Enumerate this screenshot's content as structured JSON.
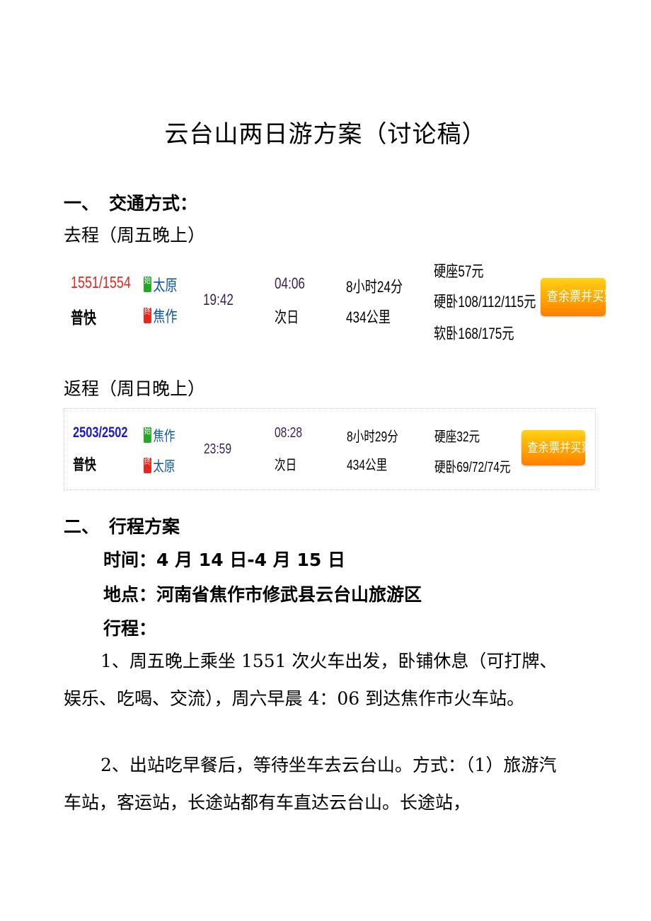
{
  "title": "云台山两日游方案（讨论稿）",
  "section1": {
    "number": "一、",
    "heading": "交通方式：",
    "outbound_label": "去程（周五晚上）",
    "return_label": "返程（周日晚上）"
  },
  "trains": [
    {
      "code": "1551/1554",
      "code_color": "#e8261c",
      "type": "普快",
      "start_badge": "始",
      "from": "太原",
      "end_badge": "终",
      "to": "焦作",
      "depart": "19:42",
      "arrive": "04:06",
      "arrive_day": "次日",
      "duration": "8小时24分",
      "distance": "434公里",
      "prices": [
        "硬座57元",
        "硬卧108/112/115元",
        "软卧168/175元"
      ],
      "button": "查余票并买票"
    },
    {
      "code": "2503/2502",
      "code_color": "#1a1acc",
      "type": "普快",
      "start_badge": "始",
      "from": "焦作",
      "end_badge": "终",
      "to": "太原",
      "depart": "23:59",
      "arrive": "08:28",
      "arrive_day": "次日",
      "duration": "8小时29分",
      "distance": "434公里",
      "prices": [
        "硬座32元",
        "硬卧69/72/74元"
      ],
      "button": "查余票并买票"
    }
  ],
  "section2": {
    "number": "二、",
    "heading": "行程方案",
    "time": "时间：4 月 14 日-4 月 15 日",
    "place": "地点：河南省焦作市修武县云台山旅游区",
    "itinerary_label": "行程：",
    "paragraphs": [
      "1、周五晚上乘坐 1551 次火车出发，卧铺休息（可打牌、娱乐、吃喝、交流），周六早晨 4：06 到达焦作市火车站。",
      "2、出站吃早餐后，等待坐车去云台山。方式：（1）旅游汽车站，客运站，长途站都有车直达云台山。长途站，"
    ]
  },
  "colors": {
    "station": "#0a55a8",
    "button_top": "#ffd21a",
    "button_bottom": "#ff7f00"
  }
}
